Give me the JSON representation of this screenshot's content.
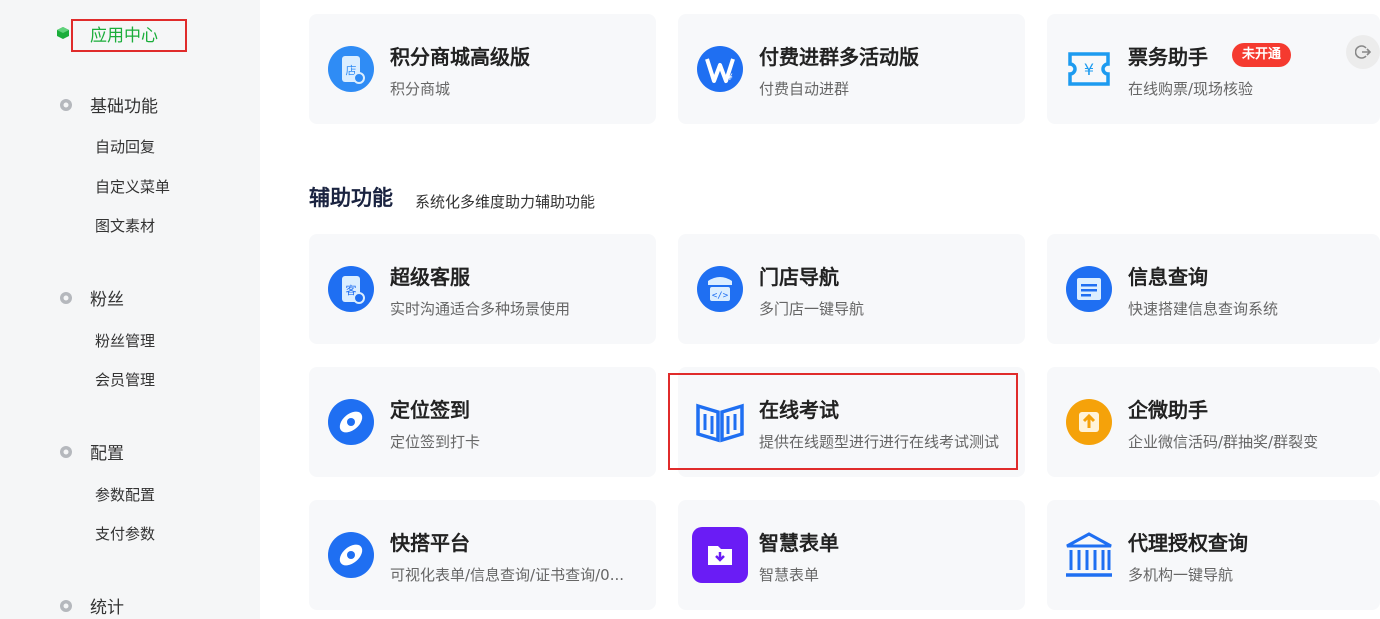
{
  "sidebar": {
    "active": "应用中心",
    "groups": [
      {
        "label": "基础功能",
        "items": [
          "自动回复",
          "自定义菜单",
          "图文素材"
        ]
      },
      {
        "label": "粉丝",
        "items": [
          "粉丝管理",
          "会员管理"
        ]
      },
      {
        "label": "配置",
        "items": [
          "参数配置",
          "支付参数"
        ]
      },
      {
        "label": "统计",
        "items": []
      }
    ]
  },
  "top_cards": [
    {
      "title": "积分商城高级版",
      "desc": "积分商城",
      "icon": "store-icon"
    },
    {
      "title": "付费进群多活动版",
      "desc": "付费自动进群",
      "icon": "paid-group-icon"
    },
    {
      "title": "票务助手",
      "desc": "在线购票/现场核验",
      "icon": "ticket-icon",
      "badge": "未开通"
    }
  ],
  "section": {
    "title": "辅助功能",
    "subtitle": "系统化多维度助力辅助功能"
  },
  "cards": [
    {
      "title": "超级客服",
      "desc": "实时沟通适合多种场景使用",
      "icon": "customer-service-icon"
    },
    {
      "title": "门店导航",
      "desc": "多门店一键导航",
      "icon": "store-navigation-icon"
    },
    {
      "title": "信息查询",
      "desc": "快速搭建信息查询系统",
      "icon": "info-query-icon"
    },
    {
      "title": "定位签到",
      "desc": "定位签到打卡",
      "icon": "location-checkin-icon"
    },
    {
      "title": "在线考试",
      "desc": "提供在线题型进行进行在线考试测试",
      "icon": "book-icon"
    },
    {
      "title": "企微助手",
      "desc": "企业微信活码/群抽奖/群裂变",
      "icon": "wecom-assistant-icon"
    },
    {
      "title": "快搭平台",
      "desc": "可视化表单/信息查询/证书查询/0...",
      "icon": "quick-build-icon"
    },
    {
      "title": "智慧表单",
      "desc": "智慧表单",
      "icon": "smart-form-icon"
    },
    {
      "title": "代理授权查询",
      "desc": "多机构一键导航",
      "icon": "authorization-icon"
    }
  ],
  "colors": {
    "accent_green": "#1aad3a",
    "brand_blue": "#1677ff",
    "highlight_red": "#e02b2b",
    "badge_red": "#f53a2f"
  }
}
